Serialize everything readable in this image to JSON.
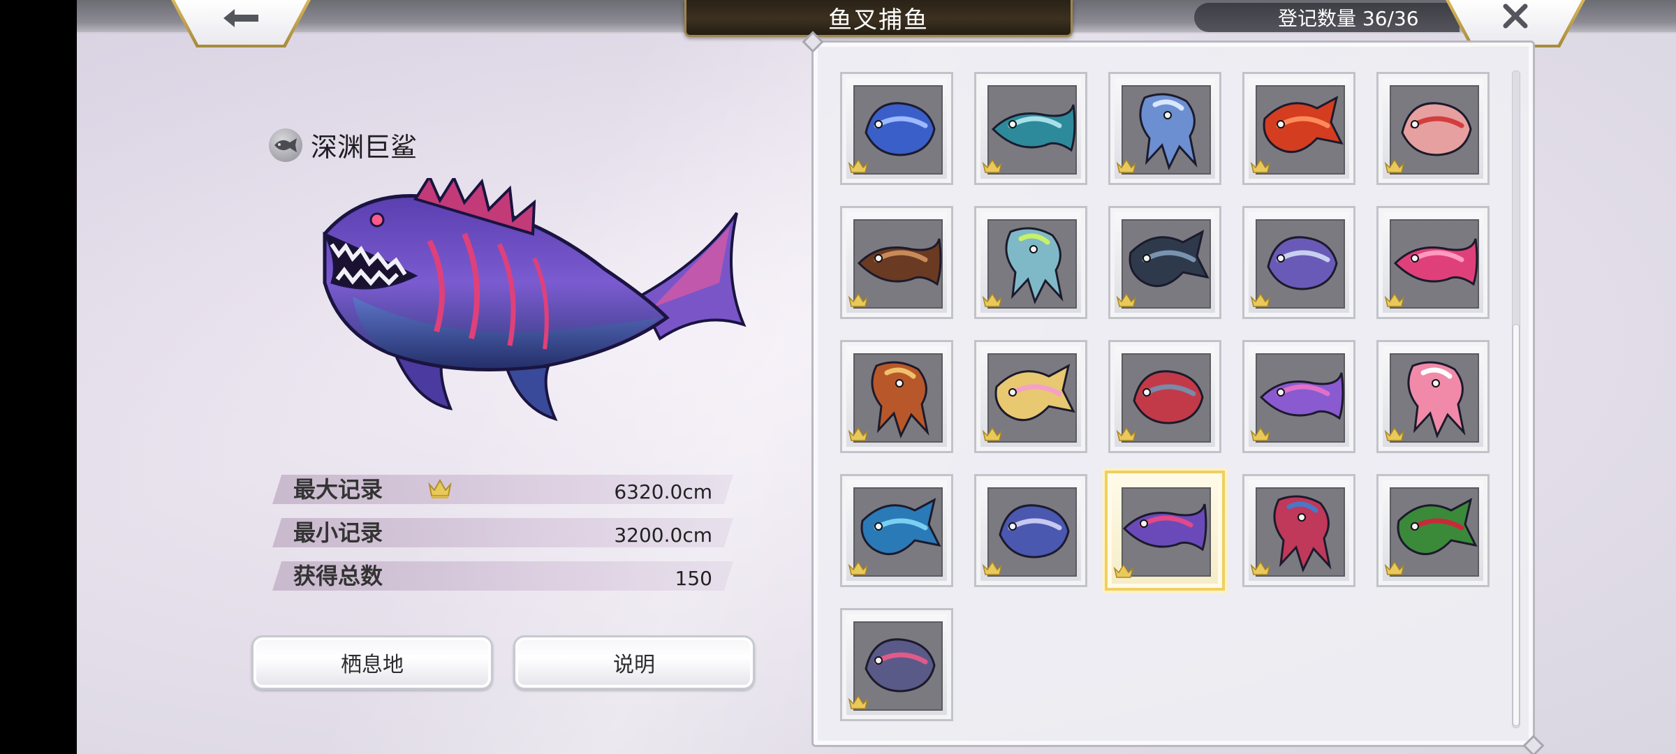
{
  "header": {
    "title": "鱼叉捕鱼",
    "count_label": "登记数量 36/36",
    "back_icon": "arrow-left-icon",
    "close_icon": "close-x-icon"
  },
  "detail": {
    "name": "深渊巨鲨",
    "stats": [
      {
        "label": "最大记录",
        "value": "6320.0cm",
        "crown": true
      },
      {
        "label": "最小记录",
        "value": "3200.0cm",
        "crown": false
      },
      {
        "label": "获得总数",
        "value": "150",
        "crown": false
      }
    ],
    "buttons": {
      "habitat": "栖息地",
      "explain": "说明"
    }
  },
  "collection": {
    "selected_index": 17,
    "items": [
      {
        "icon": "blue-octopus-icon",
        "color": "#3a5fc8",
        "accent": "#9db9ff",
        "crown": true
      },
      {
        "icon": "spider-crab-icon",
        "color": "#2c8a9a",
        "accent": "#a8e0e8",
        "crown": true
      },
      {
        "icon": "jellyfish-icon",
        "color": "#6b8fd0",
        "accent": "#d9e6ff",
        "crown": true
      },
      {
        "icon": "red-puffer-icon",
        "color": "#d43d1f",
        "accent": "#ff8a5c",
        "crown": true
      },
      {
        "icon": "sea-slug-icon",
        "color": "#e6a0a0",
        "accent": "#d43d3d",
        "crown": true
      },
      {
        "icon": "brown-eel-icon",
        "color": "#6a3a22",
        "accent": "#c98a5a",
        "crown": true
      },
      {
        "icon": "sunfish-icon",
        "color": "#7fb9c8",
        "accent": "#c8f06a",
        "crown": true
      },
      {
        "icon": "dark-shark-icon",
        "color": "#2e3a4c",
        "accent": "#7a94b0",
        "crown": true
      },
      {
        "icon": "purple-fish-icon",
        "color": "#6a5ab8",
        "accent": "#c8d0f0",
        "crown": true
      },
      {
        "icon": "pink-serpents-icon",
        "color": "#e0407a",
        "accent": "#ff9ac0",
        "crown": true
      },
      {
        "icon": "lionfish-icon",
        "color": "#b8582a",
        "accent": "#f0c06a",
        "crown": true
      },
      {
        "icon": "glow-jellyfish-icon",
        "color": "#e8c870",
        "accent": "#f4a0c8",
        "crown": true
      },
      {
        "icon": "red-shark-icon",
        "color": "#c23a48",
        "accent": "#7a8aa8",
        "crown": true
      },
      {
        "icon": "seahorse-coral-icon",
        "color": "#8a5ad0",
        "accent": "#e070c8",
        "crown": true
      },
      {
        "icon": "pink-axolotl-icon",
        "color": "#f08aa8",
        "accent": "#ffffff",
        "crown": true
      },
      {
        "icon": "blue-dragon-icon",
        "color": "#2a7ab8",
        "accent": "#7ad0f0",
        "crown": true
      },
      {
        "icon": "sea-beast-icon",
        "color": "#4a58b0",
        "accent": "#c8c8f0",
        "crown": true
      },
      {
        "icon": "abyss-shark-icon",
        "color": "#6a4ab8",
        "accent": "#e04a8a",
        "crown": true
      },
      {
        "icon": "crimson-dragon-icon",
        "color": "#c0385a",
        "accent": "#4a78c8",
        "crown": true
      },
      {
        "icon": "green-kraken-icon",
        "color": "#3a8a3a",
        "accent": "#c82a3a",
        "crown": true
      },
      {
        "icon": "swordfish-icon",
        "color": "#5a5a88",
        "accent": "#e05a8a",
        "crown": true
      }
    ]
  },
  "colors": {
    "title_plate": "#2a2217",
    "gold_trim": "#d9b75a",
    "selected_border": "#f0cf62",
    "crown": "#e8c95a"
  }
}
